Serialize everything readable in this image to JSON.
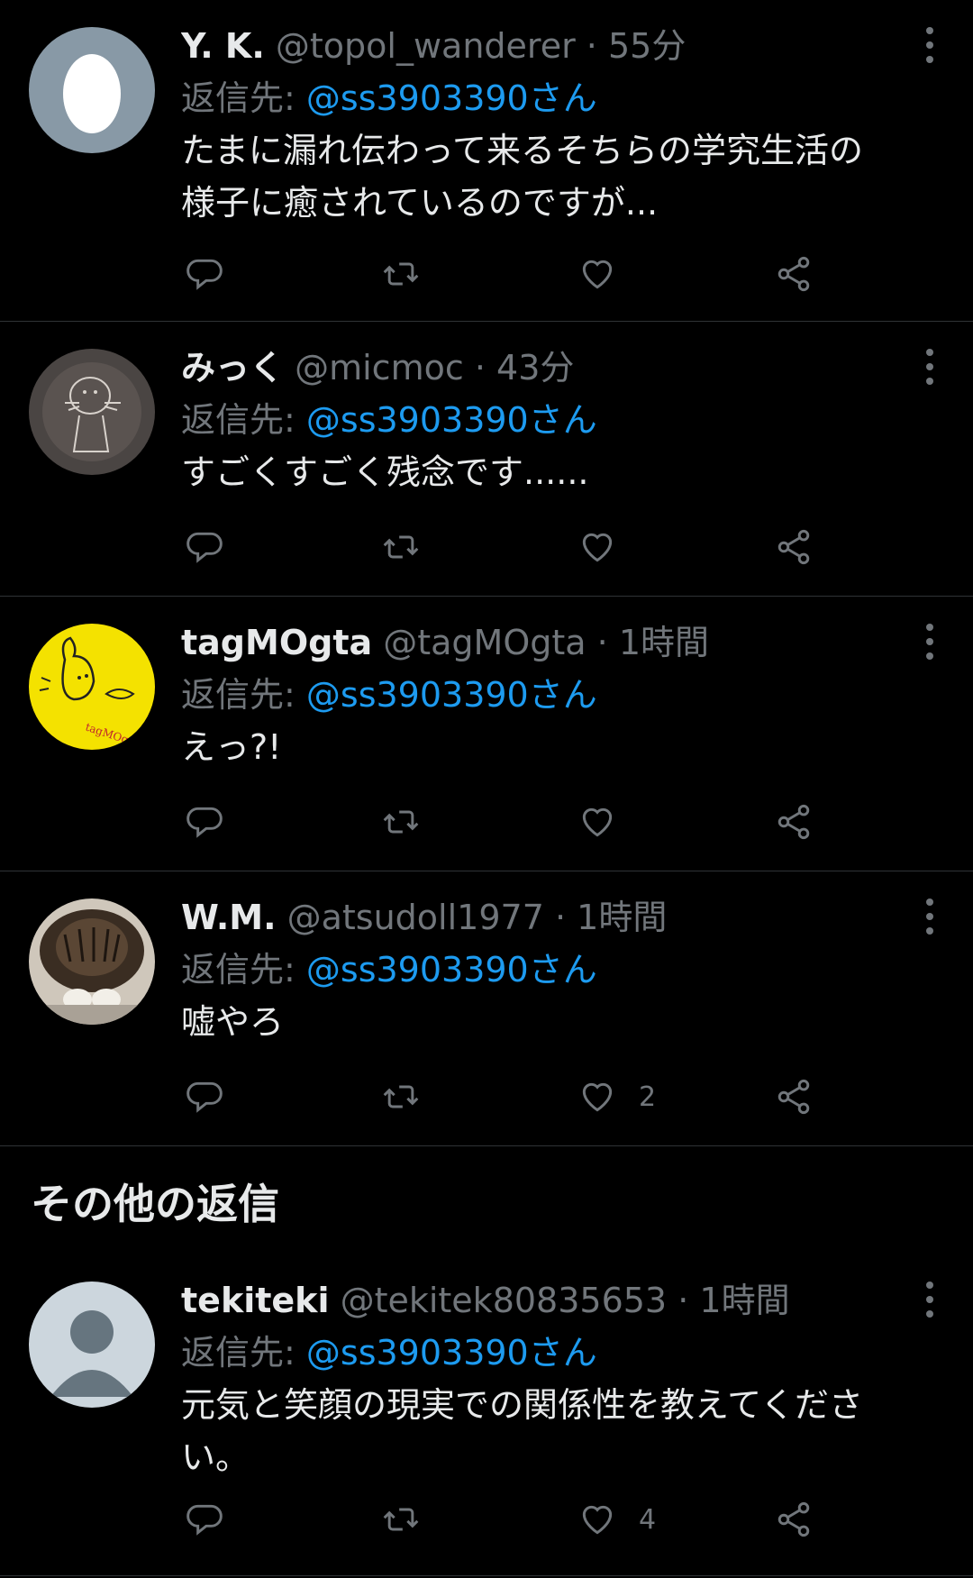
{
  "tweets": [
    {
      "name": "Y. K.",
      "handle": "@topol_wanderer",
      "sep": "·",
      "time": "55分",
      "reply_label": "返信先: ",
      "reply_to": "@ss3903390さん",
      "text_lines": [
        "たまに漏れ伝わって来るそちらの学究生活の",
        "様子に癒されているのですが..."
      ],
      "likes": "",
      "avatar": "egg-avatar"
    },
    {
      "name": "みっく",
      "handle": "@micmoc",
      "sep": "·",
      "time": "43分",
      "reply_label": "返信先: ",
      "reply_to": "@ss3903390さん",
      "text_lines": [
        "すごくすごく残念です......"
      ],
      "likes": "",
      "avatar": "sketch-avatar"
    },
    {
      "name": "tagMOgta",
      "handle": "@tagMOgta",
      "sep": "·",
      "time": "1時間",
      "reply_label": "返信先: ",
      "reply_to": "@ss3903390さん",
      "text_lines": [
        "えっ?!"
      ],
      "likes": "",
      "avatar": "yellow-drawing-avatar",
      "avatar_text": "tagMOgta©"
    },
    {
      "name": "W.M.",
      "handle": "@atsudoll1977",
      "sep": "·",
      "time": "1時間",
      "reply_label": "返信先: ",
      "reply_to": "@ss3903390さん",
      "text_lines": [
        "嘘やろ"
      ],
      "likes": "2",
      "avatar": "cat-photo-avatar"
    }
  ],
  "section": {
    "title": "その他の返信"
  },
  "more_tweet": {
    "name": "tekiteki",
    "handle": "@tekitek80835653",
    "sep": "·",
    "time": "1時間",
    "reply_label": "返信先: ",
    "reply_to": "@ss3903390さん",
    "text_lines": [
      "元気と笑顔の現実での関係性を教えてくださ",
      "い。"
    ],
    "likes": "4",
    "avatar": "default-person-avatar"
  },
  "colors": {
    "background": "#000000",
    "text": "#e7e9ea",
    "muted": "#71767b",
    "link": "#1d9bf0",
    "divider": "#2f3336"
  },
  "icons": [
    "reply-icon",
    "retweet-icon",
    "like-icon",
    "share-icon",
    "more-icon"
  ]
}
